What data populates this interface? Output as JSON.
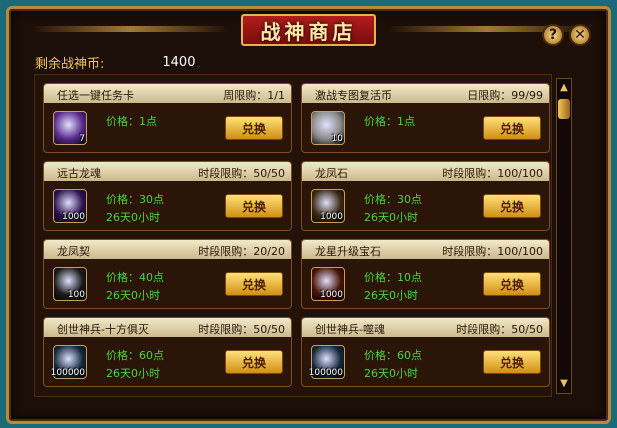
{
  "title": "战神商店",
  "buttons": {
    "help": "?",
    "close": "✕"
  },
  "currency": {
    "label": "剩余战神币:",
    "value": "1400"
  },
  "buy_label": "兑换",
  "items": [
    {
      "name": "任选一键任务卡",
      "limit": "周限购：1/1",
      "price": "价格：1点",
      "time": "",
      "qty": "7",
      "icon": "purple-card-icon",
      "color": "#5a2a8c"
    },
    {
      "name": "激战专图复活币",
      "limit": "日限购：99/99",
      "price": "价格：1点",
      "time": "",
      "qty": "10",
      "icon": "silver-coin-icon",
      "color": "#8a8a8a"
    },
    {
      "name": "远古龙魂",
      "limit": "时段限购：50/50",
      "price": "价格：30点",
      "time": "26天0小时",
      "qty": "1000",
      "icon": "dragon-soul-icon",
      "color": "#2e1450"
    },
    {
      "name": "龙凤石",
      "limit": "时段限购：100/100",
      "price": "价格：30点",
      "time": "26天0小时",
      "qty": "1000",
      "icon": "dragon-phoenix-stone-icon",
      "color": "#3a2a14"
    },
    {
      "name": "龙凤契",
      "limit": "时段限购：20/20",
      "price": "价格：40点",
      "time": "26天0小时",
      "qty": "100",
      "icon": "jade-ring-icon",
      "color": "#1a1a1a"
    },
    {
      "name": "龙星升级宝石",
      "limit": "时段限购：100/100",
      "price": "价格：10点",
      "time": "26天0小时",
      "qty": "1000",
      "icon": "fire-gem-icon",
      "color": "#4a1408"
    },
    {
      "name": "创世神兵-十方俱灭",
      "limit": "时段限购：50/50",
      "price": "价格：60点",
      "time": "26天0小时",
      "qty": "100000",
      "icon": "sword-orb-icon",
      "color": "#142a3a"
    },
    {
      "name": "创世神兵-噬魂",
      "limit": "时段限购：50/50",
      "price": "价格：60点",
      "time": "26天0小时",
      "qty": "100000",
      "icon": "soul-orb-icon",
      "color": "#14283a"
    }
  ]
}
